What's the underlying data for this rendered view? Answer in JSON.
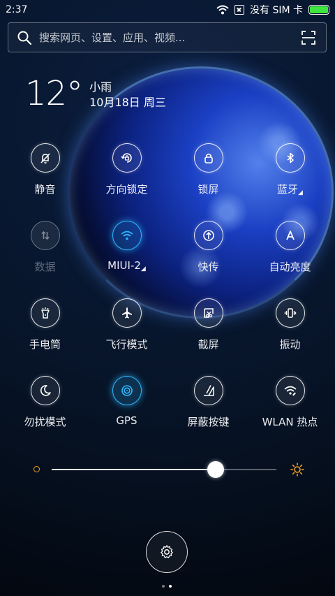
{
  "status_bar": {
    "time": "2:37",
    "carrier": "没有 SIM 卡",
    "icons": [
      "wifi-icon",
      "no-sim-icon",
      "battery-icon"
    ],
    "battery_level": 1.0,
    "battery_color": "#3ee53e"
  },
  "search": {
    "placeholder": "搜索网页、设置、应用、视频...",
    "icon": "search-icon",
    "scan_icon": "scan-icon"
  },
  "weather": {
    "temperature": "12°",
    "condition": "小雨",
    "date": "10月18日 周三"
  },
  "toggles": [
    {
      "id": "mute",
      "label": "静音",
      "icon": "bell-off-icon",
      "state": "off",
      "corner": ""
    },
    {
      "id": "rotation",
      "label": "方向锁定",
      "icon": "rotation-lock-icon",
      "state": "off",
      "corner": ""
    },
    {
      "id": "lock",
      "label": "锁屏",
      "icon": "lock-icon",
      "state": "off",
      "corner": ""
    },
    {
      "id": "bluetooth",
      "label": "蓝牙",
      "icon": "bluetooth-icon",
      "state": "off",
      "corner": "◢"
    },
    {
      "id": "data",
      "label": "数据",
      "icon": "data-icon",
      "state": "disabled",
      "corner": ""
    },
    {
      "id": "wifi",
      "label": "MIUI-2",
      "icon": "wifi-icon",
      "state": "on",
      "corner": "◢"
    },
    {
      "id": "share",
      "label": "快传",
      "icon": "quick-share-icon",
      "state": "off",
      "corner": ""
    },
    {
      "id": "auto_brightness",
      "label": "自动亮度",
      "icon": "auto-brightness-icon",
      "state": "off",
      "corner": ""
    },
    {
      "id": "flashlight",
      "label": "手电筒",
      "icon": "flashlight-icon",
      "state": "off",
      "corner": ""
    },
    {
      "id": "airplane",
      "label": "飞行模式",
      "icon": "airplane-icon",
      "state": "off",
      "corner": ""
    },
    {
      "id": "screenshot",
      "label": "截屏",
      "icon": "screenshot-icon",
      "state": "off",
      "corner": ""
    },
    {
      "id": "vibrate",
      "label": "振动",
      "icon": "vibrate-icon",
      "state": "off",
      "corner": ""
    },
    {
      "id": "dnd",
      "label": "勿扰模式",
      "icon": "moon-icon",
      "state": "off",
      "corner": ""
    },
    {
      "id": "gps",
      "label": "GPS",
      "icon": "gps-icon",
      "state": "on",
      "corner": ""
    },
    {
      "id": "block_keys",
      "label": "屏蔽按键",
      "icon": "block-keys-icon",
      "state": "off",
      "corner": ""
    },
    {
      "id": "hotspot",
      "label": "WLAN 热点",
      "icon": "hotspot-icon",
      "state": "off",
      "corner": ""
    }
  ],
  "brightness": {
    "level": 0.73,
    "min_icon": "sun-small-icon",
    "max_icon": "sun-large-icon",
    "icon_color": "#f0a020"
  },
  "settings": {
    "icon": "gear-icon"
  },
  "pager": {
    "count": 2,
    "active": 1
  },
  "colors": {
    "accent": "#2fb8ff",
    "background": "#071428"
  }
}
